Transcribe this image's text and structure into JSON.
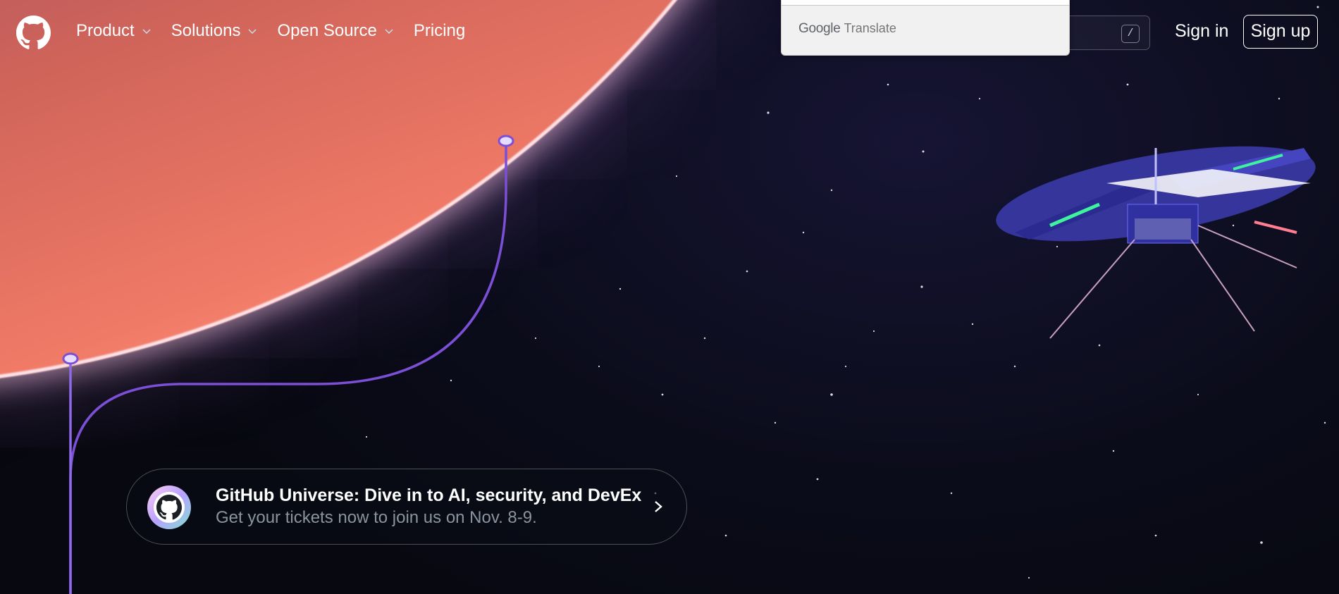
{
  "nav": {
    "items": [
      {
        "label": "Product",
        "has_dropdown": true
      },
      {
        "label": "Solutions",
        "has_dropdown": true
      },
      {
        "label": "Open Source",
        "has_dropdown": true
      },
      {
        "label": "Pricing",
        "has_dropdown": false
      }
    ]
  },
  "header": {
    "search_shortcut": "/",
    "sign_in": "Sign in",
    "sign_up": "Sign up"
  },
  "translate_popup": {
    "brand": "Google",
    "product": "Translate"
  },
  "banner": {
    "title": "GitHub Universe: Dive in to AI, security, and DevEx",
    "subtitle": "Get your tickets now to join us on Nov. 8-9."
  },
  "icons": {
    "logo": "github-mark-icon",
    "dropdown": "chevron-down-icon",
    "banner_logo": "universe-octocat-icon",
    "banner_arrow": "chevron-right-icon"
  },
  "colors": {
    "background": "#0d1117",
    "trail": "#7b4fd6",
    "planet_glow": "#f07a66",
    "subtitle": "#8b949e"
  }
}
